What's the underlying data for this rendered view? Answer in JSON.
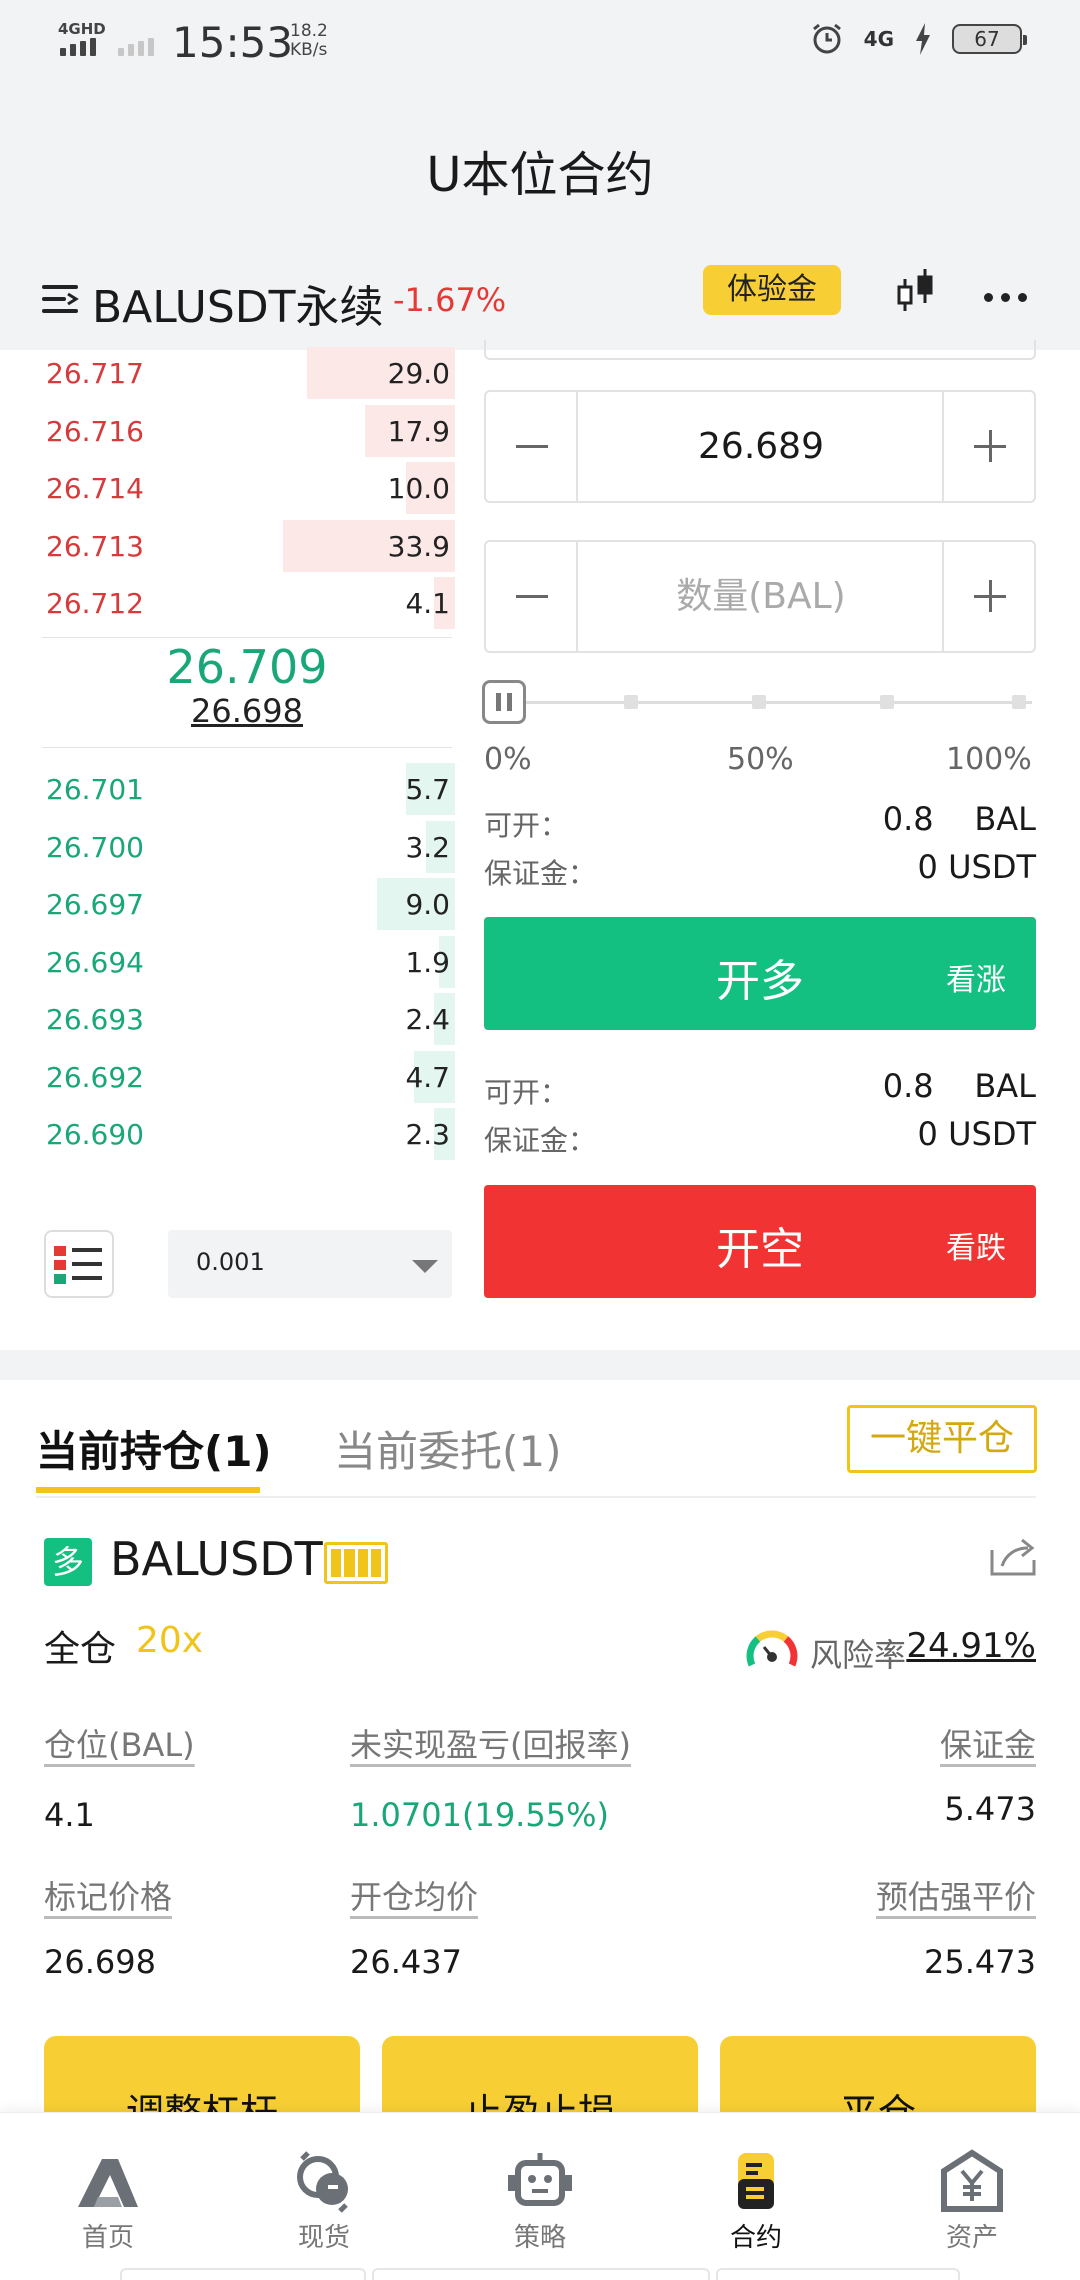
{
  "status_bar": {
    "network": "4GHD",
    "time": "15:53",
    "speed_value": "18.2",
    "speed_unit": "KB/s",
    "network_right": "4G",
    "battery": "67"
  },
  "header": {
    "title": "U本位合约",
    "symbol": "BALUSDT永续",
    "change": "-1.67%",
    "trial_label": "体验金"
  },
  "order_book": {
    "asks": [
      {
        "price": "26.717",
        "qty": "29.0",
        "depth": 0.36
      },
      {
        "price": "26.716",
        "qty": "17.9",
        "depth": 0.22
      },
      {
        "price": "26.714",
        "qty": "10.0",
        "depth": 0.12
      },
      {
        "price": "26.713",
        "qty": "33.9",
        "depth": 0.42
      },
      {
        "price": "26.712",
        "qty": "4.1",
        "depth": 0.05
      }
    ],
    "last_price": "26.709",
    "mark_price": "26.698",
    "bids": [
      {
        "price": "26.701",
        "qty": "5.7",
        "depth": 0.12
      },
      {
        "price": "26.700",
        "qty": "3.2",
        "depth": 0.07
      },
      {
        "price": "26.697",
        "qty": "9.0",
        "depth": 0.19
      },
      {
        "price": "26.694",
        "qty": "1.9",
        "depth": 0.04
      },
      {
        "price": "26.693",
        "qty": "2.4",
        "depth": 0.05
      },
      {
        "price": "26.692",
        "qty": "4.7",
        "depth": 0.1
      },
      {
        "price": "26.690",
        "qty": "2.3",
        "depth": 0.05
      }
    ],
    "precision": "0.001"
  },
  "order_form": {
    "price_value": "26.689",
    "amount_placeholder": "数量(BAL)",
    "slider_marks": [
      "0%",
      "50%",
      "100%"
    ],
    "slider_level": 0,
    "long": {
      "open_label": "可开：",
      "open_value": "0.8    BAL",
      "margin_label": "保证金：",
      "margin_value": "0 USDT",
      "button": "开多",
      "button_sub": "看涨"
    },
    "short": {
      "open_label": "可开：",
      "open_value": "0.8    BAL",
      "margin_label": "保证金：",
      "margin_value": "0 USDT",
      "button": "开空",
      "button_sub": "看跌"
    }
  },
  "positions": {
    "tab_active": "当前持仓(1)",
    "tab_inactive": "当前委托(1)",
    "close_all": "一键平仓",
    "side_badge": "多",
    "symbol": "BALUSDT",
    "margin_mode": "全仓",
    "leverage": "20x",
    "risk_label": "风险率",
    "risk_value": "24.91%",
    "fields": {
      "size_label": "仓位(BAL)",
      "size_value": "4.1",
      "pnl_label": "未实现盈亏(回报率)",
      "pnl_value": "1.0701(19.55%)",
      "margin_label": "保证金",
      "margin_value": "5.473",
      "mark_label": "标记价格",
      "mark_value": "26.698",
      "entry_label": "开仓均价",
      "entry_value": "26.437",
      "liq_label": "预估强平价",
      "liq_value": "25.473"
    },
    "actions": [
      "调整杠杆",
      "止盈止损",
      "平仓"
    ]
  },
  "nav": [
    {
      "label": "首页",
      "icon": "home-logo-icon"
    },
    {
      "label": "现货",
      "icon": "spot-exchange-icon"
    },
    {
      "label": "策略",
      "icon": "robot-icon"
    },
    {
      "label": "合约",
      "icon": "contract-icon"
    },
    {
      "label": "资产",
      "icon": "assets-yen-icon"
    }
  ],
  "colors": {
    "green": "#14bf82",
    "red": "#f23333",
    "yellow": "#f7cf34"
  }
}
